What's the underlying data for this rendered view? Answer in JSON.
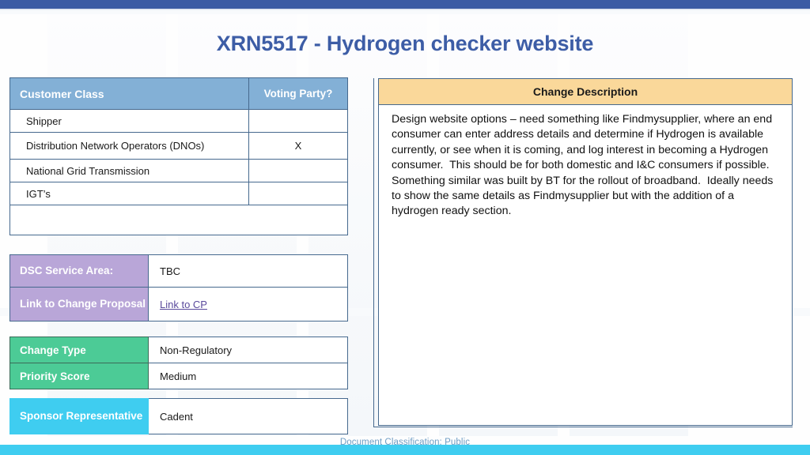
{
  "slide": {
    "title": "XRN5517 - Hydrogen checker website",
    "footer": "Document Classification: Public",
    "title_color": "#3d5da6",
    "top_bar_color": "#3b5ba4",
    "bottom_bar_color": "#3fcdf0"
  },
  "customer_table": {
    "headers": [
      "Customer Class",
      "Voting Party?"
    ],
    "header_color": "#83b0d6",
    "rows": [
      {
        "name": "Shipper",
        "voting": ""
      },
      {
        "name": "Distribution Network Operators (DNOs)",
        "voting": "X"
      },
      {
        "name": "National Grid Transmission",
        "voting": ""
      },
      {
        "name": "IGT’s",
        "voting": ""
      }
    ],
    "trailing_blank_row": ""
  },
  "dsc_table": {
    "label_color": "#b9a6d8",
    "rows": [
      {
        "label": "DSC Service Area:",
        "value": "TBC",
        "is_link": false
      },
      {
        "label": "Link to Change Proposal",
        "value": "Link to CP",
        "is_link": true
      }
    ]
  },
  "change_table": {
    "label_color": "#4ccb96",
    "rows": [
      {
        "label": "Change Type",
        "value": "Non-Regulatory"
      },
      {
        "label": "Priority Score",
        "value": "Medium"
      }
    ]
  },
  "sponsor_table": {
    "label_color": "#3fcdf0",
    "rows": [
      {
        "label": "Sponsor Representative",
        "value": "Cadent"
      }
    ]
  },
  "description_panel": {
    "header": "Change Description",
    "header_color": "#fad89a",
    "body": "Design website options – need something like Findmysupplier, where an end consumer can enter address details and determine if Hydrogen is available currently, or see when it is coming, and log interest in becoming a Hydrogen consumer.  This should be for both domestic and I&C consumers if possible.  Something similar was built by BT for the rollout of broadband.  Ideally needs to show the same details as Findmysupplier but with the addition of a hydrogen ready section."
  }
}
